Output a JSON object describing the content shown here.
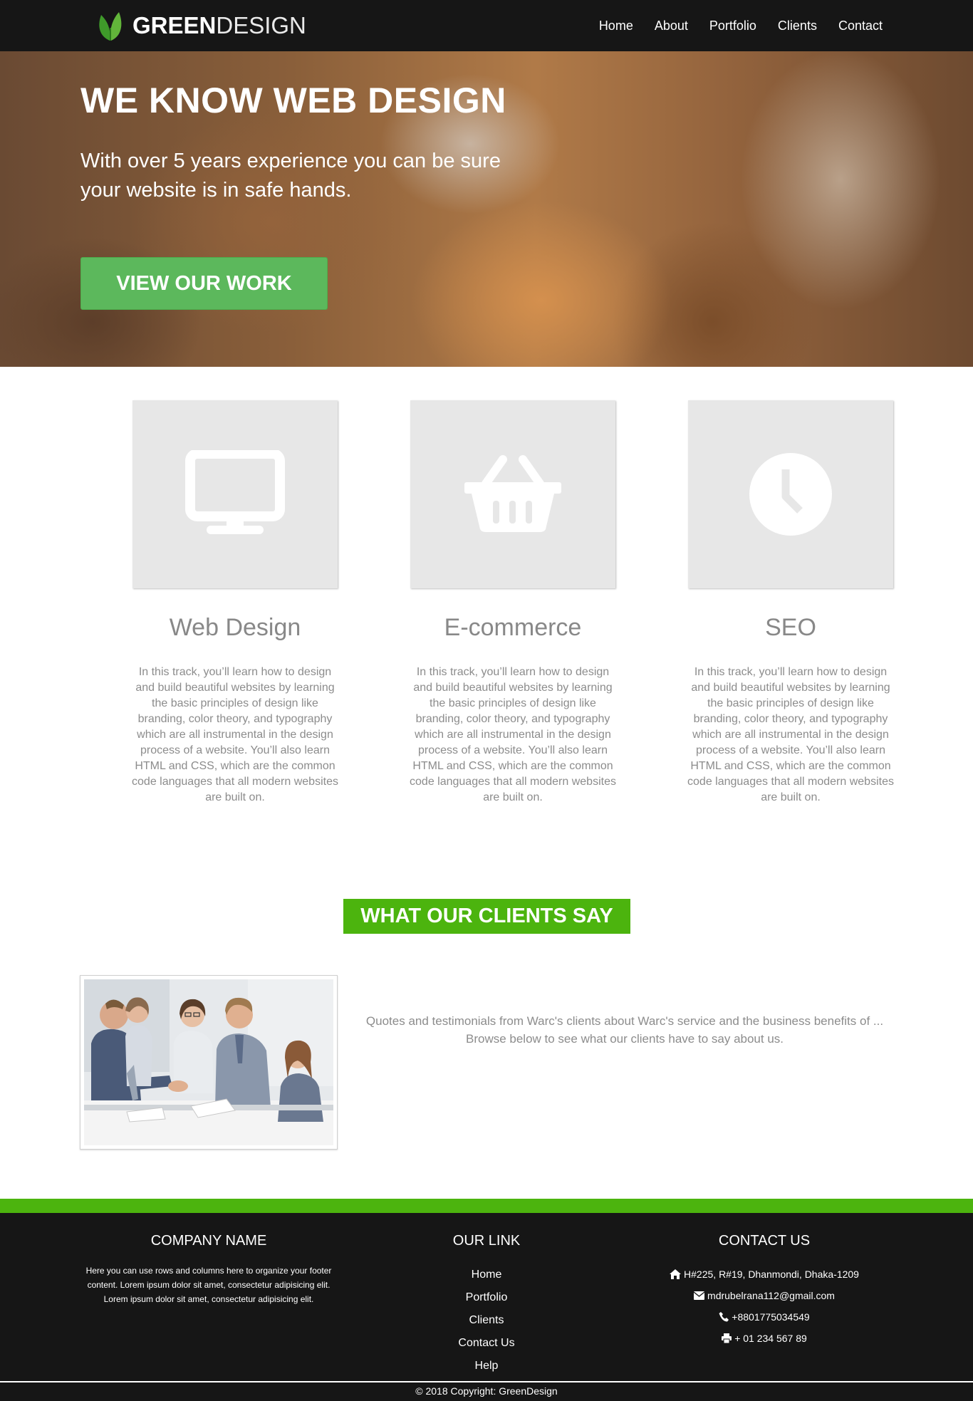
{
  "nav": {
    "logo_bold": "GREEN",
    "logo_light": "DESIGN",
    "links": [
      "Home",
      "About",
      "Portfolio",
      "Clients",
      "Contact"
    ]
  },
  "hero": {
    "title": "WE KNOW WEB DESIGN",
    "subtitle": "With over 5 years experience you can be sure your website is in safe hands.",
    "button": "VIEW OUR WORK"
  },
  "services": [
    {
      "icon": "monitor-icon",
      "title": "Web Design",
      "text": "In this track, you’ll learn how to design and build beautiful websites by learning the basic principles of design like branding, color theory, and typography which are all instrumental in the design process of a website. You’ll also learn HTML and CSS, which are the common code languages that all modern websites are built on."
    },
    {
      "icon": "basket-icon",
      "title": "E-commerce",
      "text": "In this track, you’ll learn how to design and build beautiful websites by learning the basic principles of design like branding, color theory, and typography which are all instrumental in the design process of a website. You’ll also learn HTML and CSS, which are the common code languages that all modern websites are built on."
    },
    {
      "icon": "clock-icon",
      "title": "SEO",
      "text": "In this track, you’ll learn how to design and build beautiful websites by learning the basic principles of design like branding, color theory, and typography which are all instrumental in the design process of a website. You’ll also learn HTML and CSS, which are the common code languages that all modern websites are built on."
    }
  ],
  "clients": {
    "title": "WHAT OUR CLIENTS SAY",
    "quote": "Quotes and testimonials from Warc's clients about Warc's service and the business benefits of ... Browse below to see what our clients have to say about us."
  },
  "footer": {
    "company": {
      "title": "COMPANY NAME",
      "text": "Here you can use rows and columns here to organize your footer content. Lorem ipsum dolor sit amet, consectetur adipisicing elit. Lorem ipsum dolor sit amet, consectetur adipisicing elit."
    },
    "links": {
      "title": "OUR LINK",
      "items": [
        "Home",
        "Portfolio",
        "Clients",
        "Contact Us",
        "Help"
      ]
    },
    "contact": {
      "title": "CONTACT US",
      "address": "H#225, R#19, Dhanmondi, Dhaka-1209",
      "email": "mdrubelrana112@gmail.com",
      "phone": "+8801775034549",
      "fax": "+ 01 234 567 89"
    },
    "copyright": "© 2018 Copyright: GreenDesign"
  },
  "colors": {
    "accent_green": "#4cb40e",
    "button_green": "#5cb85c",
    "dark": "#161616"
  }
}
